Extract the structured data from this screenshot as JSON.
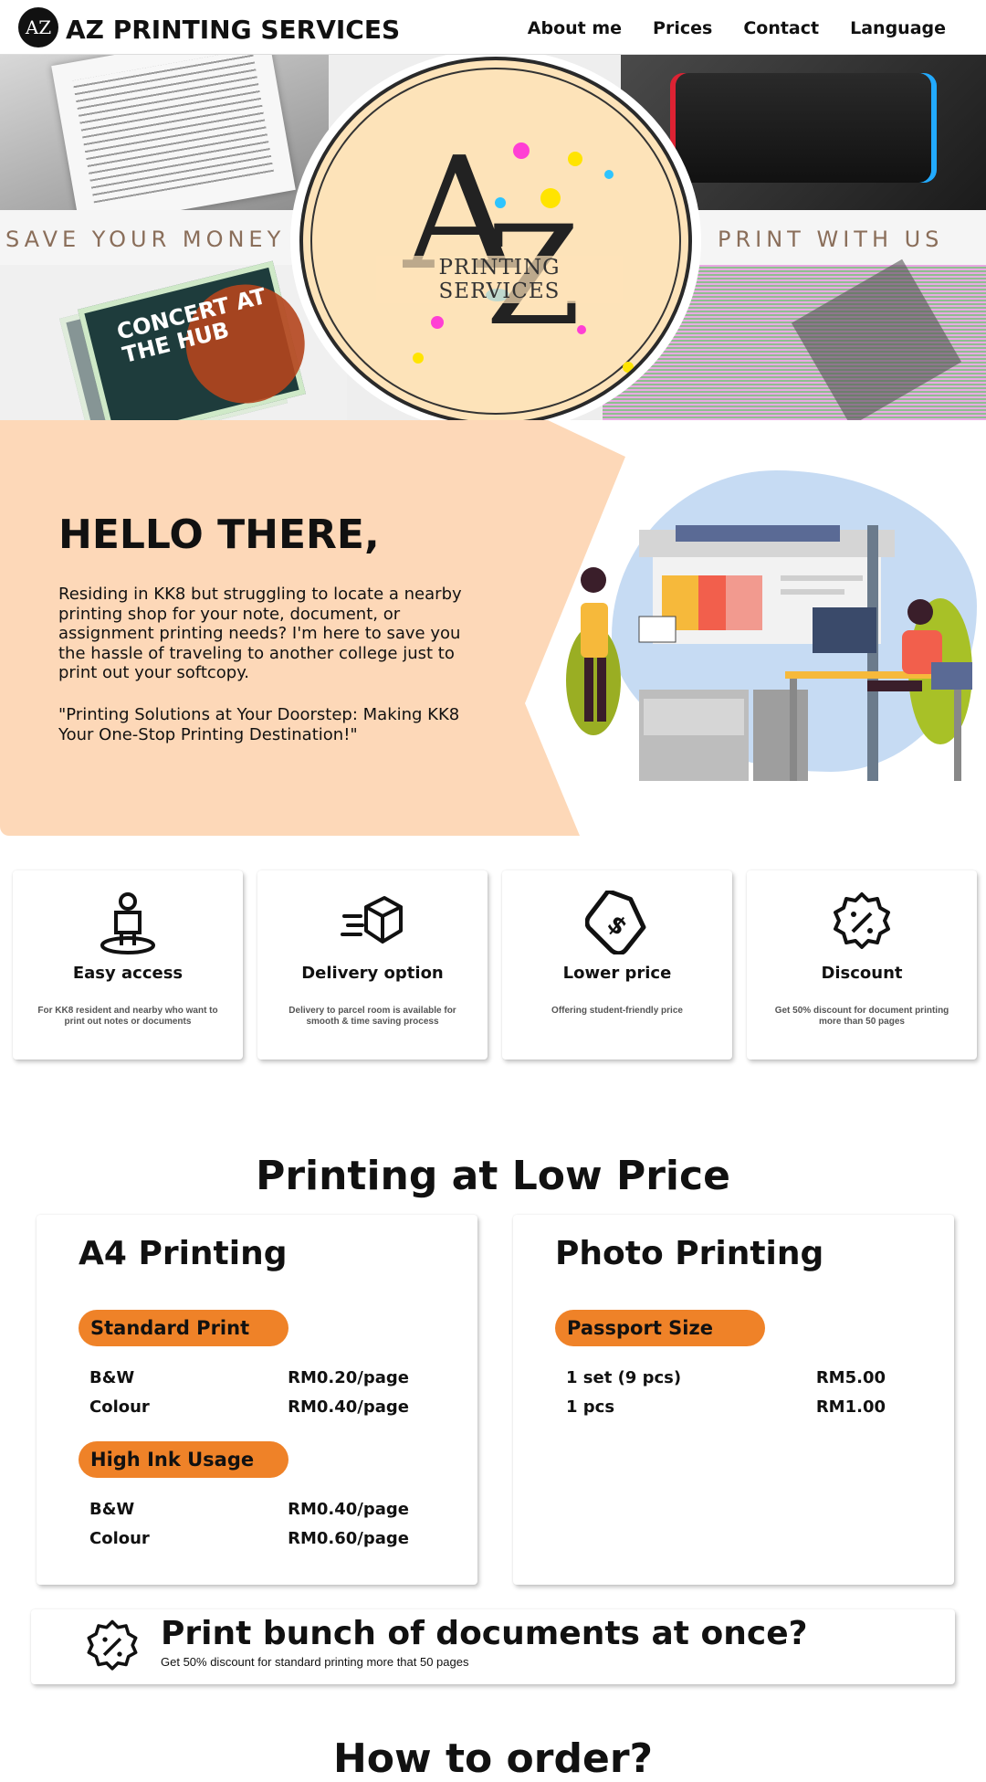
{
  "nav": {
    "logo_text": "AZ",
    "brand": "AZ PRINTING SERVICES",
    "links": [
      "About me",
      "Prices",
      "Contact",
      "Language"
    ]
  },
  "hero": {
    "left_banner": "SAVE YOUR MONEY",
    "right_banner": "PRINT WITH US",
    "logo_letter_a": "A",
    "logo_letter_z": "Z",
    "logo_subtitle": "PRINTING SERVICES",
    "poster_text": "CONCERT AT THE HUB"
  },
  "intro": {
    "heading": "HELLO THERE,",
    "paragraph": "Residing in KK8 but struggling to locate a nearby printing shop for your note, document, or assignment printing needs? I'm here to save you the hassle of traveling to another college just to print out your softcopy.",
    "tagline": "\"Printing Solutions at Your Doorstep: Making KK8 Your One-Stop Printing Destination!\""
  },
  "features": [
    {
      "title": "Easy access",
      "desc": "For KK8 resident and nearby who want to print out notes or documents",
      "icon": "person-pin-icon"
    },
    {
      "title": "Delivery option",
      "desc": "Delivery to parcel room is available for smooth & time saving process",
      "icon": "fast-box-icon"
    },
    {
      "title": "Lower price",
      "desc": "Offering student-friendly price",
      "icon": "price-tag-icon"
    },
    {
      "title": "Discount",
      "desc": "Get 50% discount for document printing more than 50 pages",
      "icon": "discount-badge-icon"
    }
  ],
  "pricing": {
    "title": "Printing at Low Price",
    "a4": {
      "title": "A4 Printing",
      "standard": {
        "label": "Standard Print",
        "rows": [
          {
            "name": "B&W",
            "price": "RM0.20/page"
          },
          {
            "name": "Colour",
            "price": "RM0.40/page"
          }
        ]
      },
      "high_ink": {
        "label": "High Ink Usage",
        "rows": [
          {
            "name": "B&W",
            "price": "RM0.40/page"
          },
          {
            "name": "Colour",
            "price": "RM0.60/page"
          }
        ]
      }
    },
    "photo": {
      "title": "Photo Printing",
      "passport": {
        "label": "Passport Size",
        "rows": [
          {
            "name": "1 set (9 pcs)",
            "price": "RM5.00"
          },
          {
            "name": "1 pcs",
            "price": "RM1.00"
          }
        ]
      }
    }
  },
  "bulk": {
    "title": "Print bunch of documents at once?",
    "desc": "Get 50% discount for standard printing more that 50 pages"
  },
  "next_section_title": "How to order?",
  "colors": {
    "accent": "#ef8228",
    "peach": "#fdd8b8",
    "text": "#111111"
  }
}
